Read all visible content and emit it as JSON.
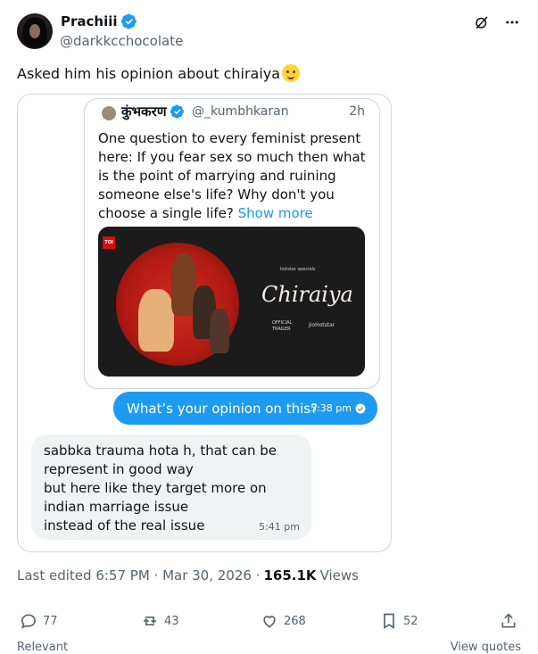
{
  "author": {
    "name": "Prachiii",
    "handle": "@darkkcchocolate"
  },
  "tweet": {
    "text": "Asked him  his opinion about chiraiya"
  },
  "quote": {
    "name": "कुंभकरण",
    "handle": "@_kumbhkaran",
    "time": "2h",
    "text": "One question to every feminist present here: If you fear sex so much then what is the point of marrying and ruining someone else's life? Why don't you choose a single life?",
    "show_more": "Show more",
    "media": {
      "badge": "TOI",
      "brand": "hotstar specials",
      "title": "Chiraiya",
      "official": "OFFICIAL",
      "trailer": "TRAILER",
      "platform": "JioHotstar"
    }
  },
  "messages": [
    {
      "text": "What’s your opinion on this?",
      "time": "5:38 pm"
    },
    {
      "text": "sabbka trauma hota h,  that can be represent in good way\nbut here like they target more on indian marriage issue\ninstead of the real issue",
      "time": "5:41 pm"
    }
  ],
  "meta": {
    "edited": "Last edited 6:57 PM · Mar 30, 2026 ·",
    "views_count": "165.1K",
    "views_label": "Views"
  },
  "actions": {
    "replies": "77",
    "reposts": "43",
    "likes": "268",
    "bookmarks": "52"
  },
  "footer": {
    "relevant": "Relevant",
    "view_quotes": "View quotes"
  }
}
